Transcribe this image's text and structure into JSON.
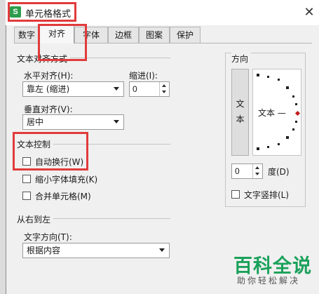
{
  "window": {
    "title": "单元格格式",
    "app_icon_glyph": "S"
  },
  "tabs": [
    {
      "label": "数字",
      "active": false
    },
    {
      "label": "对齐",
      "active": true
    },
    {
      "label": "字体",
      "active": false
    },
    {
      "label": "边框",
      "active": false
    },
    {
      "label": "图案",
      "active": false
    },
    {
      "label": "保护",
      "active": false
    }
  ],
  "alignment": {
    "section_title": "文本对齐方式",
    "horizontal_label": "水平对齐(H):",
    "horizontal_value": "靠左 (缩进)",
    "indent_label": "缩进(I):",
    "indent_value": "0",
    "vertical_label": "垂直对齐(V):",
    "vertical_value": "居中"
  },
  "text_control": {
    "section_title": "文本控制",
    "wrap_label": "自动换行(W)",
    "shrink_label": "缩小字体填充(K)",
    "merge_label": "合并单元格(M)"
  },
  "rtl": {
    "section_title": "从右到左",
    "direction_label": "文字方向(T):",
    "direction_value": "根据内容"
  },
  "orientation": {
    "title": "方向",
    "vertical_text": "文本",
    "horizontal_text": "文本 —",
    "degree_value": "0",
    "degree_label": "度(D)",
    "stacked_label": "文字竖排(L)"
  },
  "watermark": {
    "main": "百科全说",
    "sub": "助你轻松解决"
  },
  "colors": {
    "highlight": "#e13b3b",
    "watermark": "#1aa15a",
    "orientation_marker": "#c41b1b"
  }
}
